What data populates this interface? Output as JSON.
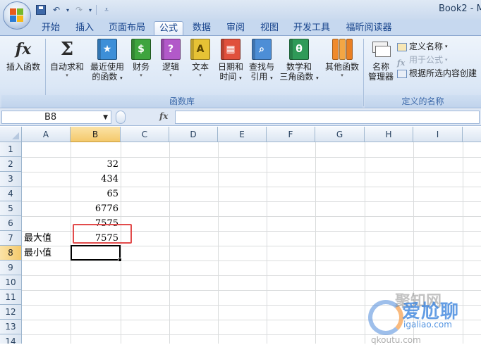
{
  "window": {
    "title": "Book2 - M"
  },
  "ribbon_tabs": [
    {
      "label": "开始"
    },
    {
      "label": "插入"
    },
    {
      "label": "页面布局"
    },
    {
      "label": "公式"
    },
    {
      "label": "数据"
    },
    {
      "label": "审阅"
    },
    {
      "label": "视图"
    },
    {
      "label": "开发工具"
    },
    {
      "label": "福昕阅读器"
    }
  ],
  "active_tab": "公式",
  "function_library": {
    "group_label": "函数库",
    "insert_function": {
      "icon": "fx",
      "label": "插入函数"
    },
    "autosum": {
      "icon": "Σ",
      "label": "自动求和"
    },
    "recently_used": {
      "line1": "最近使用",
      "line2": "的函数"
    },
    "financial": {
      "label": "财务",
      "glyph": "$"
    },
    "logical": {
      "label": "逻辑",
      "glyph": "?"
    },
    "text": {
      "label": "文本",
      "glyph": "A"
    },
    "date_time": {
      "line1": "日期和",
      "line2": "时间"
    },
    "lookup_reference": {
      "line1": "查找与",
      "line2": "引用"
    },
    "math_trig": {
      "line1": "数学和",
      "line2": "三角函数",
      "glyph": "θ"
    },
    "more_functions": {
      "label": "其他函数"
    }
  },
  "defined_names": {
    "group_label": "定义的名称",
    "name_manager": {
      "line1": "名称",
      "line2": "管理器"
    },
    "define_name": "定义名称",
    "use_in_formula": "用于公式",
    "create_from_selection": "根据所选内容创建"
  },
  "formula_bar": {
    "name_box": "B8",
    "fx": "fx",
    "value": ""
  },
  "sheet": {
    "columns": [
      "A",
      "B",
      "C",
      "D",
      "E",
      "F",
      "G",
      "H",
      "I"
    ],
    "rows": [
      "1",
      "2",
      "3",
      "4",
      "5",
      "6",
      "7",
      "8",
      "9",
      "10",
      "11",
      "12",
      "13",
      "14"
    ],
    "active_cell": "B8",
    "cells": {
      "B2": "32",
      "B3": "434",
      "B4": "65",
      "B5": "6776",
      "B6": "7575",
      "A7": "最大值",
      "B7": "7575",
      "A8": "最小值"
    }
  },
  "watermark": {
    "line1": "聚知网",
    "line2": "爱尬聊",
    "line3": "igaliao.com",
    "line4": "qkoutu.com"
  },
  "colors": {
    "ribbon_tab_text": "#15428b",
    "highlight_box": "#e24b4b",
    "selected_header": "#f4c96b"
  }
}
